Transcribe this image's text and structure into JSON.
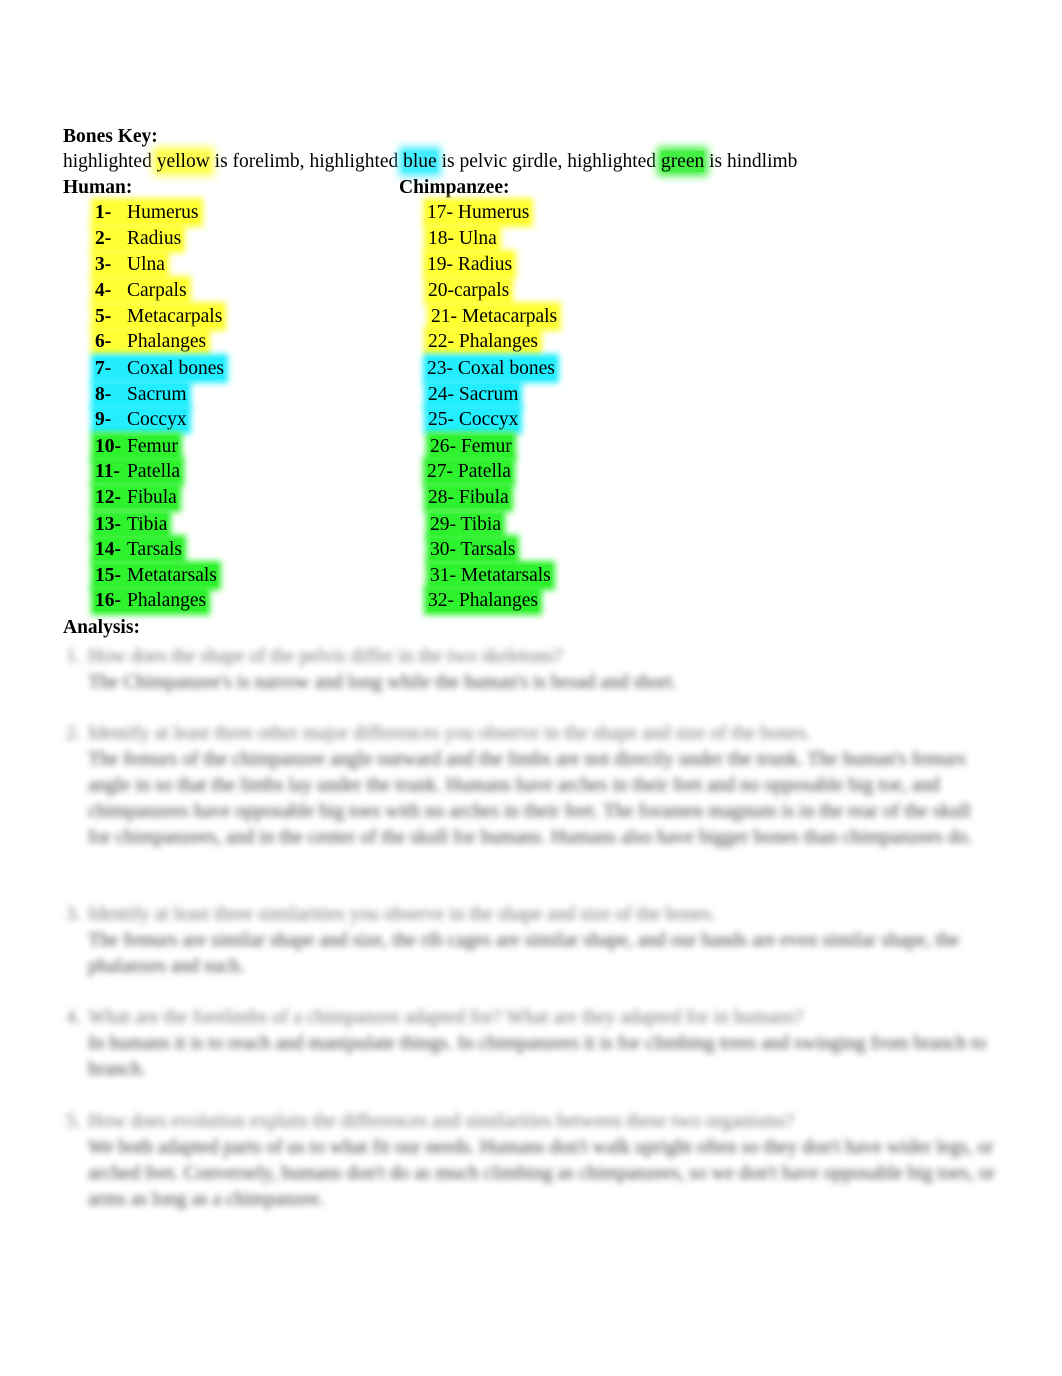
{
  "key": {
    "title": "Bones Key:",
    "legend": [
      {
        "prefix": "highlighted ",
        "word": "yellow",
        "suffix": " is forelimb, ",
        "color": "#ffff33"
      },
      {
        "prefix": "highlighted ",
        "word": "blue",
        "suffix": " is pelvic girdle, ",
        "color": "#22eeff"
      },
      {
        "prefix": "highlighted ",
        "word": "green",
        "suffix": " is hindlimb",
        "color": "#2ef22e"
      }
    ]
  },
  "human": {
    "heading": "Human:",
    "items": [
      {
        "num": "1-",
        "name": "Humerus",
        "group": "forelimb"
      },
      {
        "num": "2-",
        "name": "Radius",
        "group": "forelimb"
      },
      {
        "num": "3-",
        "name": "Ulna",
        "group": "forelimb"
      },
      {
        "num": "4-",
        "name": "Carpals",
        "group": "forelimb"
      },
      {
        "num": "5-",
        "name": "Metacarpals",
        "group": "forelimb"
      },
      {
        "num": "6-",
        "name": "Phalanges",
        "group": "forelimb"
      },
      {
        "num": "7-",
        "name": "Coxal bones",
        "group": "pelvic"
      },
      {
        "num": "8-",
        "name": "Sacrum",
        "group": "pelvic"
      },
      {
        "num": "9-",
        "name": "Coccyx",
        "group": "pelvic"
      },
      {
        "num": "10-",
        "name": "Femur",
        "group": "hindlimb"
      },
      {
        "num": "11-",
        "name": "Patella",
        "group": "hindlimb"
      },
      {
        "num": "12-",
        "name": "Fibula",
        "group": "hindlimb"
      },
      {
        "num": "13-",
        "name": "Tibia",
        "group": "hindlimb"
      },
      {
        "num": "14-",
        "name": "Tarsals",
        "group": "hindlimb"
      },
      {
        "num": "15-",
        "name": "Metatarsals",
        "group": "hindlimb"
      },
      {
        "num": "16-",
        "name": "Phalanges",
        "group": "hindlimb"
      }
    ]
  },
  "chimp": {
    "heading": "Chimpanzee:",
    "items": [
      {
        "text": "17- Humerus",
        "group": "forelimb"
      },
      {
        "text": "18- Ulna",
        "group": "forelimb"
      },
      {
        "text": "19- Radius",
        "group": "forelimb"
      },
      {
        "text": "20-carpals",
        "group": "forelimb"
      },
      {
        "text": "21- Metacarpals",
        "group": "forelimb"
      },
      {
        "text": "22- Phalanges",
        "group": "forelimb"
      },
      {
        "text": "23- Coxal bones",
        "group": "pelvic"
      },
      {
        "text": "24- Sacrum",
        "group": "pelvic"
      },
      {
        "text": "25- Coccyx",
        "group": "pelvic"
      },
      {
        "text": "26- Femur",
        "group": "hindlimb"
      },
      {
        "text": "27- Patella",
        "group": "hindlimb"
      },
      {
        "text": "28- Fibula",
        "group": "hindlimb"
      },
      {
        "text": "29- Tibia",
        "group": "hindlimb"
      },
      {
        "text": "30- Tarsals",
        "group": "hindlimb"
      },
      {
        "text": "31- Metatarsals",
        "group": "hindlimb"
      },
      {
        "text": "32- Phalanges",
        "group": "hindlimb"
      }
    ]
  },
  "analysis": {
    "heading": "Analysis:",
    "questions": [
      {
        "num": "1.",
        "question": "How does the shape of the pelvis differ in the two skeletons?",
        "answer": "The Chimpanzee's is narrow and long while the human's is broad and short."
      },
      {
        "num": "2.",
        "question": "Identify at least three other major differences you observe in the shape and size of the bones.",
        "answer": "The femurs of the chimpanzee angle outward and the limbs are not directly under the trunk. The human's femurs angle in so that the limbs lay under the trunk. Humans have arches in their feet and no opposable big toe, and chimpanzees have opposable big toes with no arches in their feet. The foramen magnum is in the rear of the skull for chimpanzees, and in the center of the skull for humans. Humans also have bigger bones than chimpanzees do."
      },
      {
        "num": "3.",
        "question": "Identify at least three similarities you observe in the shape and size of the bones.",
        "answer": "The femurs are similar shape and size, the rib cages are similar shape, and our hands are even similar shape, the phalanxes and such."
      },
      {
        "num": "4.",
        "question": "What are the forelimbs of a chimpanzee adapted for? What are they adapted for in humans?",
        "answer": "In humans it is to reach and manipulate things. In chimpanzees it is for climbing trees and swinging from branch to branch."
      },
      {
        "num": "5.",
        "question": "How does evolution explain the differences and similarities between these two organisms?",
        "answer": "We both adapted parts of us to what fit our needs. Humans don't walk upright often so they don't have wider legs, or arched feet. Conversely, humans don't do as much climbing as chimpanzees, so we don't have opposable big toes, or arms as long as a chimpanzee."
      }
    ]
  }
}
